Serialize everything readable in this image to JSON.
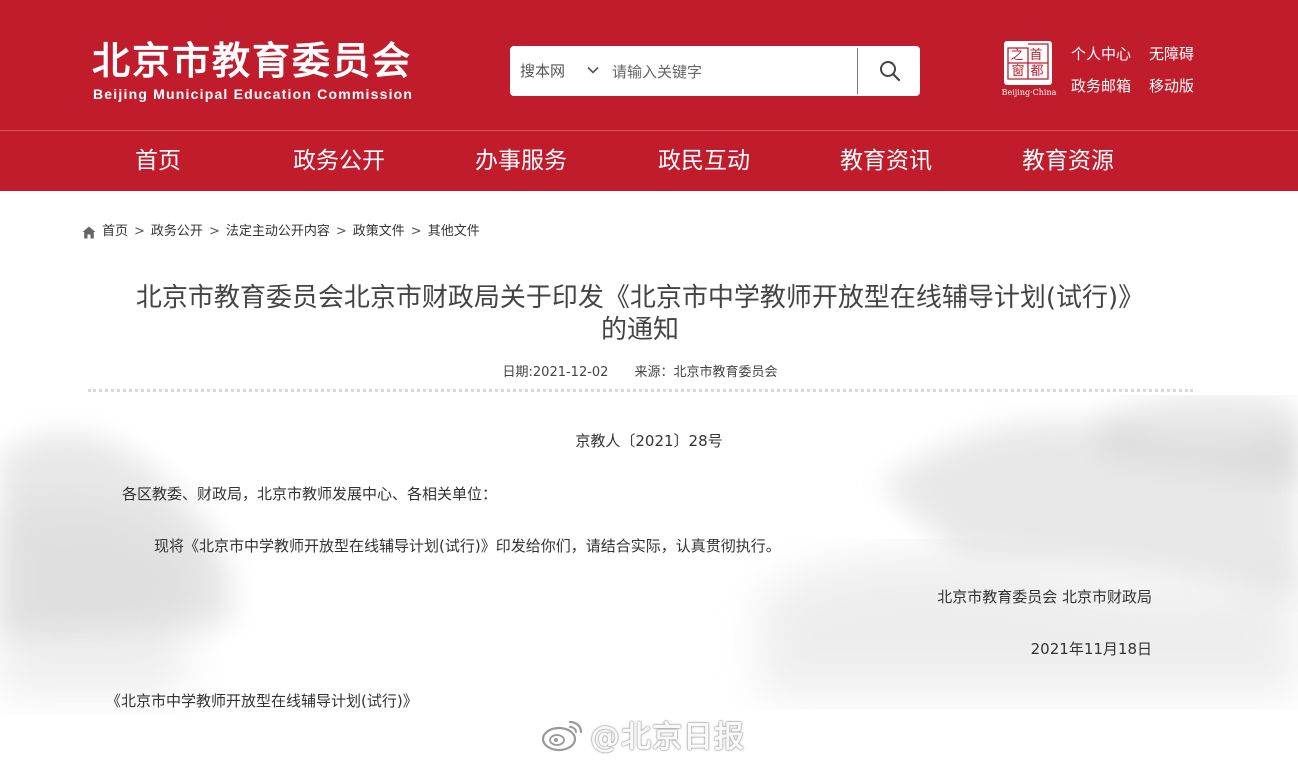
{
  "header": {
    "logo_cn": "北京市教育委员会",
    "logo_en": "Beijing Municipal Education Commission",
    "search": {
      "scope": "搜本网",
      "placeholder": "请输入关键字"
    },
    "seal": {
      "chars": [
        "首",
        "都",
        "之",
        "窗"
      ],
      "caption": "Beijing·China"
    },
    "links": [
      "个人中心",
      "无障碍",
      "政务邮箱",
      "移动版"
    ]
  },
  "nav": {
    "items": [
      "首页",
      "政务公开",
      "办事服务",
      "政民互动",
      "教育资讯",
      "教育资源"
    ]
  },
  "breadcrumb": {
    "items": [
      "首页",
      "政务公开",
      "法定主动公开内容",
      "政策文件",
      "其他文件"
    ],
    "separator": ">"
  },
  "article": {
    "title_line1": "北京市教育委员会北京市财政局关于印发《北京市中学教师开放型在线辅导计划(试行)》",
    "title_line2": "的通知",
    "date_label": "日期:2021-12-02",
    "source_label": "来源：北京市教育委员会",
    "doc_number": "京教人〔2021〕28号",
    "recipients": "各区教委、财政局，北京市教师发展中心、各相关单位：",
    "body": "现将《北京市中学教师开放型在线辅导计划(试行)》印发给你们，请结合实际，认真贯彻执行。",
    "signature": "北京市教育委员会 北京市财政局",
    "sign_date": "2021年11月18日",
    "attachment": "《北京市中学教师开放型在线辅导计划(试行)》"
  },
  "watermark": {
    "text": "@北京日报"
  },
  "colors": {
    "brand_red": "#c01c2c"
  }
}
